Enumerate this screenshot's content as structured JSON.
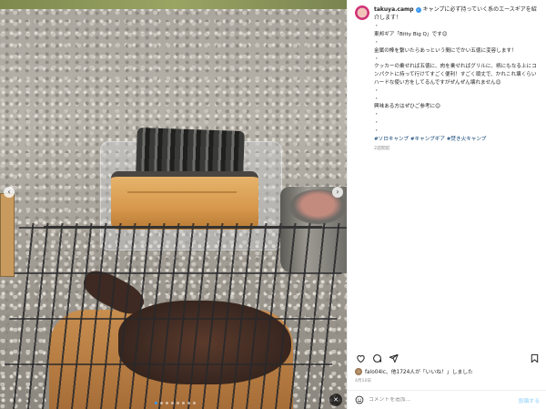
{
  "post": {
    "username": "takuya.camp",
    "caption_head": "キャンプに必ず持っていく系のエースギアを紹介します！",
    "lines": [
      "・",
      "東邦ギア「Bitty Big Q」です😊",
      "・",
      "金属の棒を繋いたらあっという間にでかい五徳に変容します！",
      "・",
      "クッカーの乗せれば五徳に、肉を乗せればグリルに、柄にもなる上にコンパクトに持って行けてすごく便利！すごく頑丈で、かれこれ壊くらいハードな使い方をしてるんですがぜんぜん壊れません😊",
      "・",
      "・",
      "興味ある方はぜひご参考に😊",
      "・",
      "・",
      "・"
    ],
    "hashtags": "#ソロキャンプ #キャンプギア #焚き火キャンプ",
    "caption_time": "2週間前",
    "likes_text": "falo04ic、他1724人が「いいね！」しました",
    "likes_user": "falo04ic",
    "date": "4月10日",
    "comment_placeholder": "コメントを追加...",
    "post_button": "投稿する"
  },
  "icons": {
    "like": "heart-icon",
    "comment": "comment-icon",
    "share": "paper-plane-icon",
    "save": "bookmark-icon",
    "emoji": "smiley-icon",
    "mute": "speaker-muted-icon"
  },
  "colors": {
    "accent": "#3897f0",
    "link": "#00376b",
    "muted": "#8e8e8e",
    "post_button": "#b2dffc"
  },
  "carousel": {
    "prev": "‹",
    "next": "›",
    "mute": "✕",
    "slide_count": 8,
    "active_index": 0
  }
}
